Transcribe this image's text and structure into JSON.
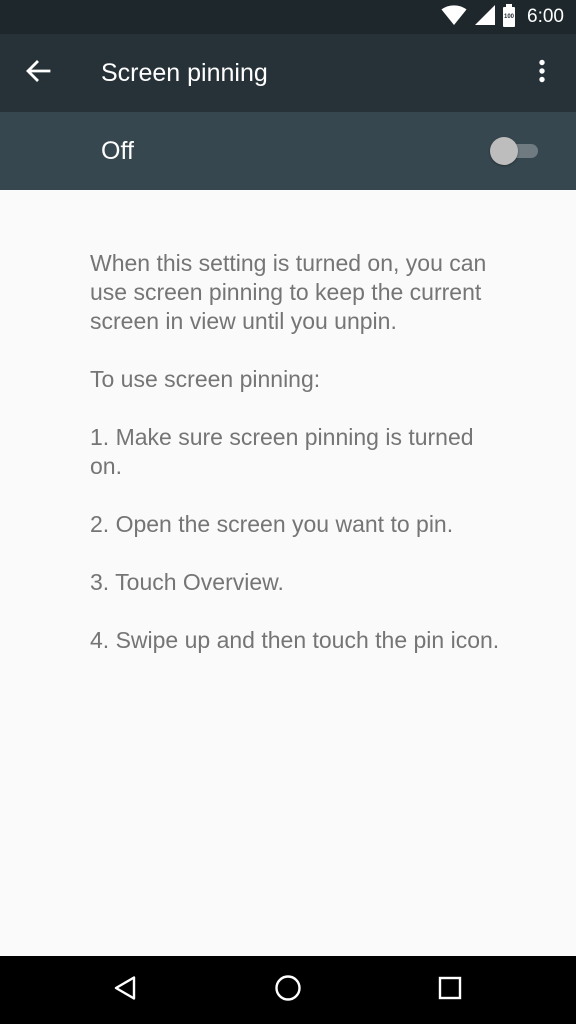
{
  "status_bar": {
    "time": "6:00",
    "battery_text": "100",
    "icons": [
      "wifi-icon",
      "cell-signal-icon",
      "battery-icon"
    ]
  },
  "app_bar": {
    "title": "Screen pinning",
    "back_icon": "arrow-back-icon",
    "overflow_icon": "more-vert-icon"
  },
  "master_switch": {
    "label": "Off",
    "checked": false
  },
  "content": {
    "paragraphs": [
      "When this setting is turned on, you can use screen pinning to keep the current screen in view until you unpin.",
      "To use screen pinning:",
      "1. Make sure screen pinning is turned on.",
      "2. Open the screen you want to pin.",
      "3. Touch Overview.",
      "4. Swipe up and then touch the pin icon."
    ]
  },
  "nav_bar": {
    "buttons": [
      "back-triangle-icon",
      "home-circle-icon",
      "overview-square-icon"
    ]
  },
  "colors": {
    "status_bar": "#1e272c",
    "app_bar": "#263238",
    "switch_bar": "#37474f",
    "background": "#fafafa",
    "body_text": "#757575"
  }
}
